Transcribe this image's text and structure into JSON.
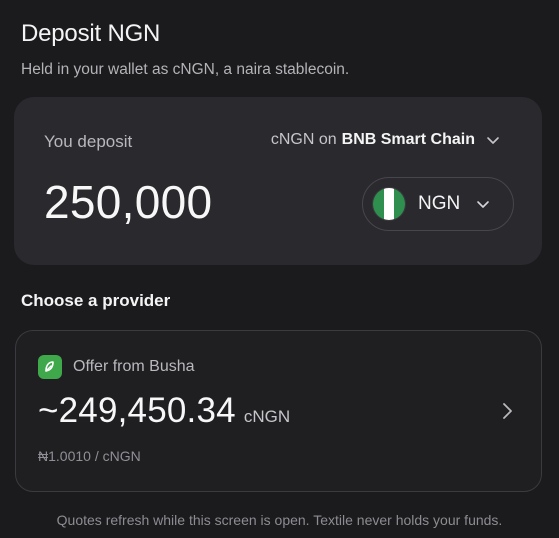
{
  "header": {
    "title": "Deposit NGN",
    "subtitle": "Held in your wallet as cNGN, a naira stablecoin."
  },
  "deposit": {
    "label": "You deposit",
    "network_prefix": "cNGN on",
    "network_name": "BNB Smart Chain",
    "amount": "250,000",
    "currency_code": "NGN",
    "flag_icon": "nigeria-flag-icon",
    "flag_colors": [
      "#2f8f4e",
      "#ffffff",
      "#2f8f4e"
    ]
  },
  "providers": {
    "label": "Choose a provider",
    "offer": {
      "provider_label": "Offer from Busha",
      "logo_icon": "busha-logo-icon",
      "logo_color": "#3fa84b",
      "quote_amount": "~249,450.34",
      "quote_unit": "cNGN",
      "rate": "₦1.0010 / cNGN"
    }
  },
  "footer": {
    "note": "Quotes refresh while this screen is open. Textile never holds your funds."
  }
}
